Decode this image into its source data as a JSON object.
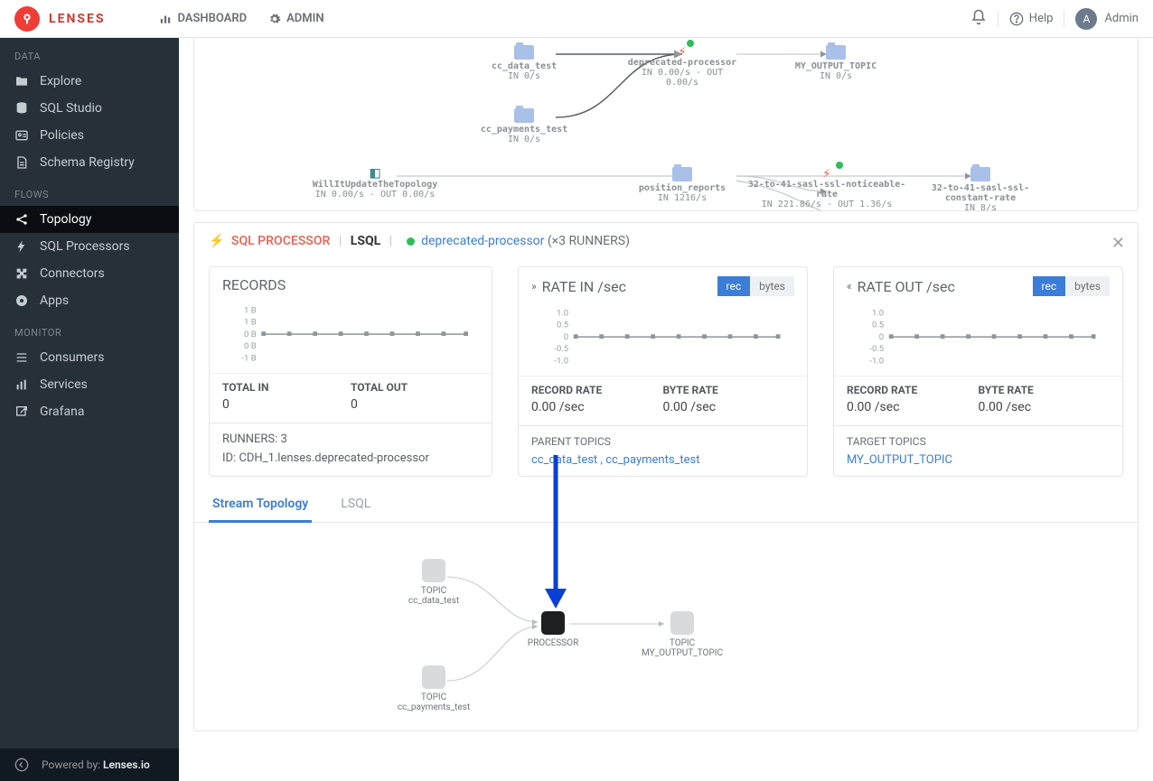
{
  "brand": "LENSES",
  "topnav": {
    "dashboard": "DASHBOARD",
    "admin": "ADMIN"
  },
  "topbar": {
    "help": "Help",
    "user": "Admin",
    "userInitial": "A"
  },
  "sidebar": {
    "sections": [
      {
        "title": "DATA",
        "items": [
          {
            "label": "Explore",
            "icon": "folder"
          },
          {
            "label": "SQL Studio",
            "icon": "db"
          },
          {
            "label": "Policies",
            "icon": "card"
          },
          {
            "label": "Schema Registry",
            "icon": "file"
          }
        ]
      },
      {
        "title": "FLOWS",
        "items": [
          {
            "label": "Topology",
            "icon": "share",
            "active": true
          },
          {
            "label": "SQL Processors",
            "icon": "bolt"
          },
          {
            "label": "Connectors",
            "icon": "puzzle"
          },
          {
            "label": "Apps",
            "icon": "circ"
          }
        ]
      },
      {
        "title": "MONITOR",
        "items": [
          {
            "label": "Consumers",
            "icon": "list"
          },
          {
            "label": "Services",
            "icon": "bars"
          },
          {
            "label": "Grafana",
            "icon": "ext"
          }
        ]
      }
    ],
    "footer": {
      "prefix": "Powered by: ",
      "brand": "Lenses.io"
    }
  },
  "graph": {
    "nodes": {
      "cc_data_test": {
        "line1": "cc_data_test",
        "line2": "IN 0/s"
      },
      "cc_payments_test": {
        "line1": "cc_payments_test",
        "line2": "IN 0/s"
      },
      "deprecated": {
        "line1": "deprecated-processor",
        "line2": "IN 0.00/s - OUT 0.00/s"
      },
      "my_output": {
        "line1": "MY_OUTPUT_TOPIC",
        "line2": "IN 0/s"
      },
      "will": {
        "line1": "WillItUpdateTheTopology",
        "line2": "IN 0.00/s - OUT 0.00/s"
      },
      "position": {
        "line1": "position_reports",
        "line2": "IN 1216/s"
      },
      "noticeable": {
        "line1": "32-to-41-sasl-ssl-noticeable-rate",
        "line2": "IN 221.86/s - OUT 1.36/s"
      },
      "constant": {
        "line1": "32-to-41-sasl-ssl-constant-rate",
        "line2": "IN 8/s"
      }
    }
  },
  "detail": {
    "badge": "SQL PROCESSOR",
    "lang": "LSQL",
    "name": "deprecated-processor",
    "runners": "(×3 RUNNERS)",
    "close": "✕"
  },
  "records": {
    "title": "RECORDS",
    "totalInLbl": "TOTAL IN",
    "totalInVal": "0",
    "totalOutLbl": "TOTAL OUT",
    "totalOutVal": "0",
    "runners": "RUNNERS: 3",
    "id": "ID: CDH_1.lenses.deprecated-processor",
    "yticks": [
      "1 B",
      "1 B",
      "0 B",
      "0 B",
      "-1 B"
    ]
  },
  "rateIn": {
    "title": "RATE IN /sec",
    "toggle": {
      "rec": "rec",
      "bytes": "bytes"
    },
    "recordLbl": "RECORD RATE",
    "recordVal": "0.00 /sec",
    "byteLbl": "BYTE RATE",
    "byteVal": "0.00 /sec",
    "footTitle": "PARENT TOPICS",
    "links": [
      "cc_data_test",
      "cc_payments_test"
    ],
    "yticks": [
      "1.0",
      "0.5",
      "0",
      "-0.5",
      "-1.0"
    ]
  },
  "rateOut": {
    "title": "RATE OUT /sec",
    "toggle": {
      "rec": "rec",
      "bytes": "bytes"
    },
    "recordLbl": "RECORD RATE",
    "recordVal": "0.00 /sec",
    "byteLbl": "BYTE RATE",
    "byteVal": "0.00 /sec",
    "footTitle": "TARGET TOPICS",
    "links": [
      "MY_OUTPUT_TOPIC"
    ],
    "yticks": [
      "1.0",
      "0.5",
      "0",
      "-0.5",
      "-1.0"
    ]
  },
  "tabs": {
    "stream": "Stream Topology",
    "lsql": "LSQL"
  },
  "stream": {
    "n1": {
      "t": "TOPIC",
      "l": "cc_data_test"
    },
    "n2": {
      "t": "TOPIC",
      "l": "cc_payments_test"
    },
    "n3": {
      "t": "PROCESSOR"
    },
    "n4": {
      "t": "TOPIC",
      "l": "MY_OUTPUT_TOPIC"
    }
  },
  "chart_data": [
    {
      "type": "line",
      "title": "RECORDS",
      "yticks": [
        "1 B",
        "1 B",
        "0 B",
        "0 B",
        "-1 B"
      ],
      "series": [
        {
          "name": "records",
          "values": [
            0,
            0,
            0,
            0,
            0,
            0,
            0,
            0,
            0
          ]
        }
      ],
      "ylim": [
        -1,
        1
      ]
    },
    {
      "type": "line",
      "title": "RATE IN /sec",
      "yticks": [
        "1.0",
        "0.5",
        "0",
        "-0.5",
        "-1.0"
      ],
      "series": [
        {
          "name": "rate_in",
          "values": [
            0,
            0,
            0,
            0,
            0,
            0,
            0,
            0,
            0
          ]
        }
      ],
      "ylim": [
        -1,
        1
      ]
    },
    {
      "type": "line",
      "title": "RATE OUT /sec",
      "yticks": [
        "1.0",
        "0.5",
        "0",
        "-0.5",
        "-1.0"
      ],
      "series": [
        {
          "name": "rate_out",
          "values": [
            0,
            0,
            0,
            0,
            0,
            0,
            0,
            0,
            0
          ]
        }
      ],
      "ylim": [
        -1,
        1
      ]
    }
  ]
}
